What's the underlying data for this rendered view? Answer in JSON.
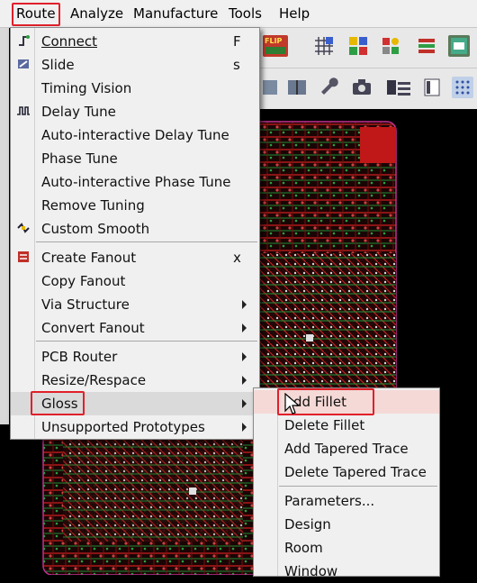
{
  "menubar": {
    "route": "Route",
    "analyze": "Analyze",
    "manufacture": "Manufacture",
    "tools": "Tools",
    "help": "Help"
  },
  "toolbar": {
    "flip_label": "FLIP",
    "colors": {
      "accent_red": "#e0202a"
    }
  },
  "route_menu": {
    "items": [
      {
        "label": "Connect",
        "shortcut": "F",
        "icon": "connect-icon"
      },
      {
        "label": "Slide",
        "shortcut": "s",
        "icon": "slide-icon"
      },
      {
        "label": "Timing Vision"
      },
      {
        "label": "Delay Tune",
        "icon": "delay-tune-icon"
      },
      {
        "label": "Auto-interactive Delay Tune"
      },
      {
        "label": "Phase Tune"
      },
      {
        "label": "Auto-interactive Phase Tune"
      },
      {
        "label": "Remove Tuning"
      },
      {
        "label": "Custom Smooth",
        "icon": "custom-smooth-icon"
      },
      {
        "label": "Create Fanout",
        "shortcut": "x",
        "icon": "create-fanout-icon"
      },
      {
        "label": "Copy Fanout"
      },
      {
        "label": "Via Structure",
        "submenu": true
      },
      {
        "label": "Convert Fanout",
        "submenu": true
      },
      {
        "label": "PCB Router",
        "submenu": true
      },
      {
        "label": "Resize/Respace",
        "submenu": true
      },
      {
        "label": "Gloss",
        "submenu": true,
        "highlighted": true
      },
      {
        "label": "Unsupported Prototypes",
        "submenu": true
      }
    ]
  },
  "gloss_submenu": {
    "items": [
      {
        "label": "Add Fillet",
        "highlighted": true
      },
      {
        "label": "Delete Fillet"
      },
      {
        "label": "Add Tapered Trace"
      },
      {
        "label": "Delete Tapered Trace"
      },
      {
        "label": "Parameters..."
      },
      {
        "label": "Design"
      },
      {
        "label": "Room"
      },
      {
        "label": "Window"
      }
    ]
  }
}
